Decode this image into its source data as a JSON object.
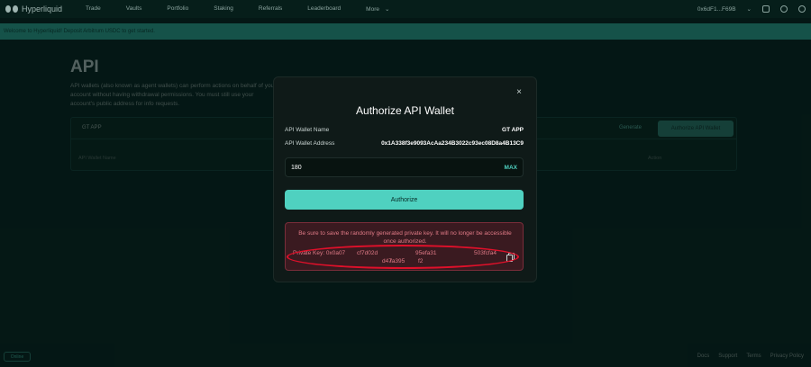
{
  "nav": {
    "brand": "Hyperliquid",
    "links": [
      "Trade",
      "Vaults",
      "Portfolio",
      "Staking",
      "Referrals",
      "Leaderboard"
    ],
    "more": "More",
    "account": "0x6dF1...F69B"
  },
  "banner": {
    "text": "Welcome to Hyperliquid! Deposit Arbitrum USDC to get started."
  },
  "page": {
    "title": "API",
    "description": "API wallets (also known as agent wallets) can perform actions on behalf of your account without having withdrawal permissions. You must still use your account's public address for info requests.",
    "card_name": "GT APP",
    "generate_label": "Generate",
    "authorize_label": "Authorize API Wallet",
    "col_name": "API Wallet Name",
    "col_action": "Action"
  },
  "footer": {
    "online": "Online",
    "links": [
      "Docs",
      "Support",
      "Terms",
      "Privacy Policy"
    ]
  },
  "modal": {
    "title": "Authorize API Wallet",
    "close": "×",
    "name_label": "API Wallet Name",
    "name_value": "GT APP",
    "address_label": "API Wallet Address",
    "address_value": "0x1A338f3e9093AcAa234B3022c93ec08D8a4B13C9",
    "days_value": "180",
    "max_label": "MAX",
    "authorize_button": "Authorize",
    "warning": "Be sure to save the randomly generated private key. It will no longer be accessible once authorized.",
    "private_key": {
      "label": "Private Key: 0x0a07",
      "part1": "cf7d02d",
      "part2": "95efa31",
      "part3": "503fcfa4",
      "part4": "d47",
      "part5": "fa395",
      "part6": "f2"
    }
  }
}
